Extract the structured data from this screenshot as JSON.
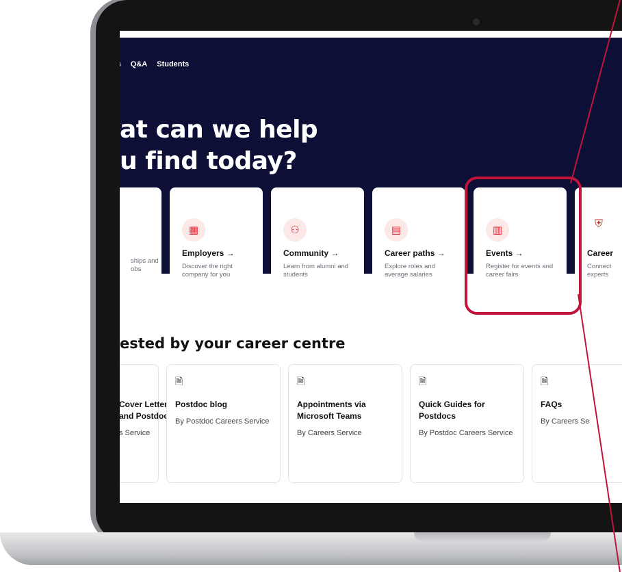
{
  "nav": {
    "items": [
      "ts",
      "Q&A",
      "Students"
    ]
  },
  "hero": {
    "headline_line1": "at can we help",
    "headline_line2": "u find today?"
  },
  "cards": [
    {
      "icon": "briefcase-icon",
      "title": "",
      "desc": "ships and\nobs"
    },
    {
      "icon": "building-icon",
      "title": "Employers →",
      "desc": "Discover the right company for you"
    },
    {
      "icon": "people-icon",
      "title": "Community →",
      "desc": "Learn from alumni and students"
    },
    {
      "icon": "id-card-icon",
      "title": "Career paths →",
      "desc": "Explore roles and average salaries"
    },
    {
      "icon": "calendar-icon",
      "title": "Events →",
      "desc": "Register for events and career fairs"
    },
    {
      "icon": "university-crest-icon",
      "title": "Career",
      "desc": "Connect\nexperts"
    }
  ],
  "section": {
    "title": "ested by your career centre"
  },
  "resources": [
    {
      "title": "Cover Letters and Postdocs",
      "by": "s Service"
    },
    {
      "title": "Postdoc blog",
      "by": "By Postdoc Careers Service"
    },
    {
      "title": "Appointments via Microsoft Teams",
      "by": "By Careers Service"
    },
    {
      "title": "Quick Guides for Postdocs",
      "by": "By Postdoc Careers Service"
    },
    {
      "title": "FAQs",
      "by": "By Careers Se"
    }
  ],
  "colors": {
    "hero_bg": "#0d0f36",
    "accent_red": "#e0262f",
    "highlight_box": "#c0143c"
  }
}
